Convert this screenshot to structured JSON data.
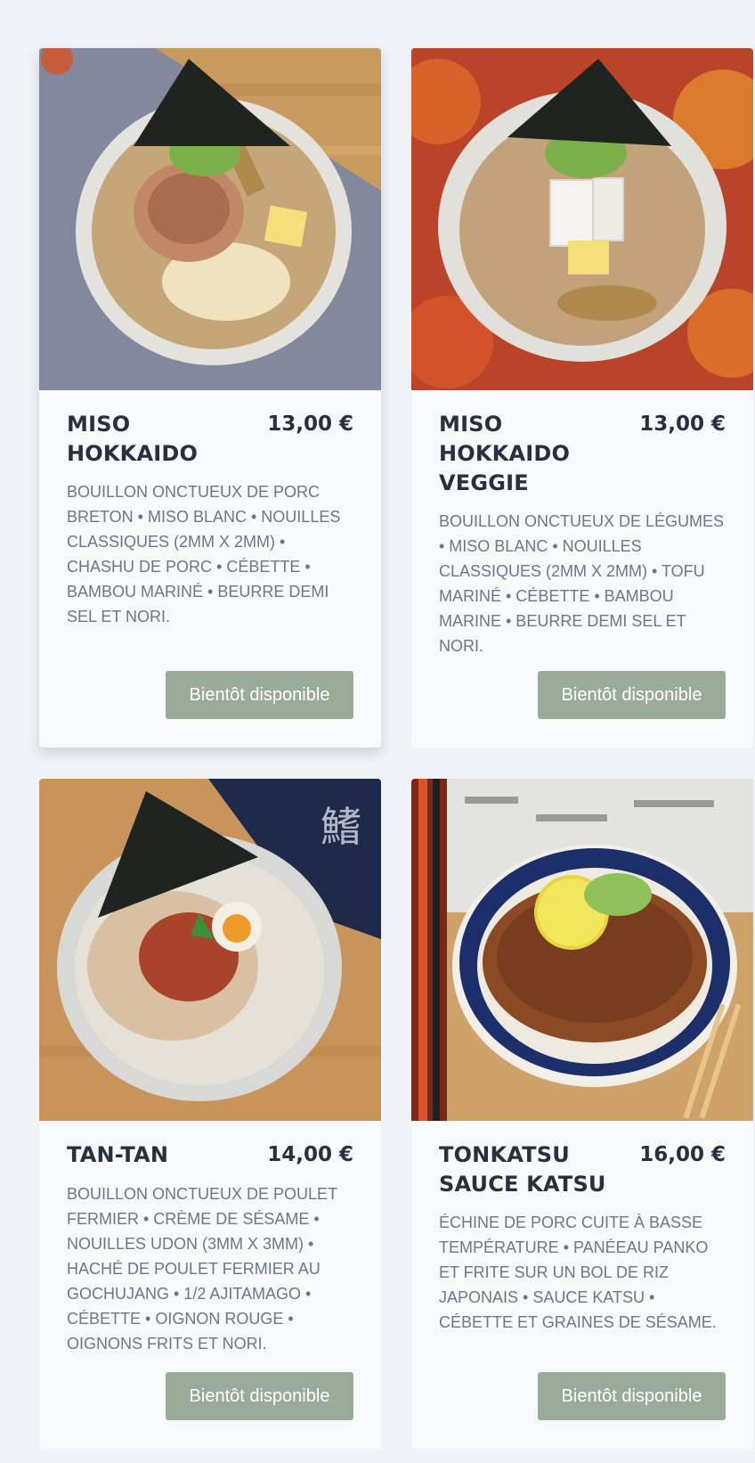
{
  "menu": {
    "items": [
      {
        "name": "MISO HOKKAIDO",
        "price": "13,00 €",
        "description": "BOUILLON ONCTUEUX DE PORC BRETON • MISO BLANC • NOUILLES CLASSIQUES (2MM X 2MM) • CHASHU DE PORC • CÉBETTE • BAMBOU MARINÉ • BEURRE DEMI SEL ET NORI.",
        "button_label": "Bientôt disponible"
      },
      {
        "name": "MISO HOKKAIDO VEGGIE",
        "price": "13,00 €",
        "description": "BOUILLON ONCTUEUX DE LÉGUMES • MISO BLANC • NOUILLES CLASSIQUES (2MM X 2MM) • TOFU MARINÉ • CÉBETTE • BAMBOU MARINE • BEURRE DEMI SEL ET NORI.",
        "button_label": "Bientôt disponible"
      },
      {
        "name": "TAN-TAN",
        "price": "14,00 €",
        "description": "BOUILLON ONCTUEUX DE POULET FERMIER • CRÈME DE SÉSAME • NOUILLES UDON (3MM X 3MM) • HACHÉ DE POULET FERMIER AU GOCHUJANG • 1/2 AJITAMAGO • CÉBETTE • OIGNON ROUGE • OIGNONS FRITS ET NORI.",
        "button_label": "Bientôt disponible"
      },
      {
        "name": "TONKATSU SAUCE KATSU",
        "price": "16,00 €",
        "description": "ÉCHINE DE PORC CUITE À BASSE TEMPÉRATURE • PANÉEAU PANKO ET FRITE SUR UN BOL DE RIZ JAPONAIS • SAUCE KATSU • CÉBETTE ET GRAINES DE SÉSAME.",
        "button_label": "Bientôt disponible"
      }
    ]
  },
  "colors": {
    "page_background": "#eff2f6",
    "card_background": "#f8f9fb",
    "title_text": "#2a2f3f",
    "description_text": "#6e7686",
    "button_background": "#9aab9a",
    "button_text": "#ffffff"
  }
}
